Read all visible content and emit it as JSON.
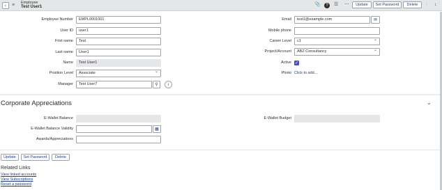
{
  "header": {
    "title": "Employee",
    "subtitle": "Test User1",
    "buttons": {
      "update": "Update",
      "set_password": "Set Password",
      "delete": "Delete"
    }
  },
  "form": {
    "left": [
      {
        "label": "Employee Number",
        "value": "EMPL0001001"
      },
      {
        "label": "User ID",
        "value": "user1"
      },
      {
        "label": "First name",
        "value": "Test"
      },
      {
        "label": "Last name",
        "value": "User1"
      },
      {
        "label": "Name",
        "value": "Test User1"
      },
      {
        "label": "Position Level",
        "value": "Associate"
      },
      {
        "label": "Manager",
        "value": "Test User7"
      }
    ],
    "right": [
      {
        "label": "Email",
        "value": "test1@example.com"
      },
      {
        "label": "Mobile phone",
        "value": ""
      },
      {
        "label": "Career Level",
        "value": "c1"
      },
      {
        "label": "Project/Account",
        "value": "ABZ Consultancy"
      },
      {
        "label": "Active",
        "value": "true"
      },
      {
        "label": "Photo",
        "value": "Click to add..."
      }
    ]
  },
  "corporate": {
    "title": "Corporate Appreciations",
    "fields": [
      {
        "label": "E-Wallet Balance",
        "value": ""
      },
      {
        "label": "E-Wallet Balance Validity",
        "value": ""
      },
      {
        "label": "Awards/Appreciations",
        "value": ""
      },
      {
        "label": "E-Wallet Budget",
        "value": ""
      }
    ]
  },
  "bottom_buttons": {
    "update": "Update",
    "set_password": "Set Password",
    "delete": "Delete"
  },
  "related_links": {
    "title": "Related Links",
    "links": [
      "View linked accounts",
      "View Subscriptions",
      "Reset a password"
    ]
  },
  "icons": {
    "back": "chevron-left-icon",
    "menu": "hamburger-icon",
    "attachment": "paperclip-icon",
    "help": "help-icon",
    "activity": "activity-stream-icon",
    "more": "ellipsis-icon",
    "email": "envelope-icon",
    "search": "search-icon",
    "info": "info-icon",
    "calendar": "calendar-icon",
    "collapse": "chevron-down-icon"
  },
  "colors": {
    "link": "#1f3f8a",
    "checkbox": "#4b4fc4",
    "header_bg": "#e4e6e7"
  }
}
